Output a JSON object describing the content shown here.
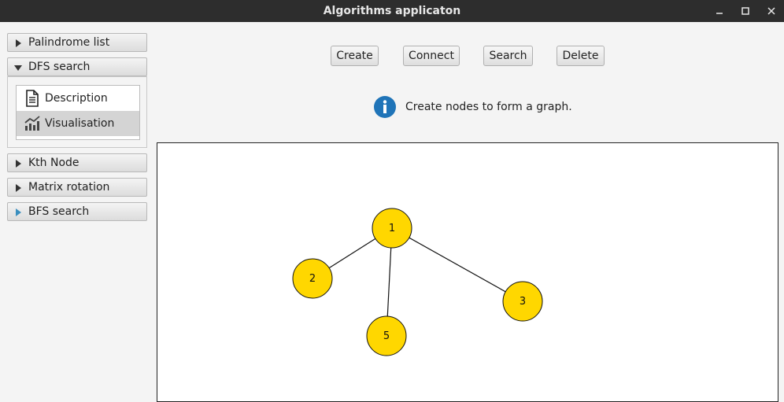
{
  "window": {
    "title": "Algorithms applicaton"
  },
  "sidebar": {
    "sections": [
      {
        "label": "Palindrome list",
        "expanded": false
      },
      {
        "label": "DFS search",
        "expanded": true
      },
      {
        "label": "Kth Node",
        "expanded": false
      },
      {
        "label": "Matrix rotation",
        "expanded": false
      },
      {
        "label": "BFS search",
        "expanded": false
      }
    ],
    "dfs_items": [
      {
        "label": "Description",
        "icon": "document-icon",
        "selected": false
      },
      {
        "label": "Visualisation",
        "icon": "chart-icon",
        "selected": true
      }
    ]
  },
  "toolbar": {
    "create_label": "Create",
    "connect_label": "Connect",
    "search_label": "Search",
    "delete_label": "Delete"
  },
  "info": {
    "icon": "info-icon",
    "message": "Create nodes to form a graph."
  },
  "graph": {
    "node_color": "#FFD700",
    "nodes": [
      {
        "id": "1",
        "label": "1"
      },
      {
        "id": "2",
        "label": "2"
      },
      {
        "id": "3",
        "label": "3"
      },
      {
        "id": "5",
        "label": "5"
      }
    ],
    "edges": [
      {
        "from": "1",
        "to": "2"
      },
      {
        "from": "1",
        "to": "3"
      },
      {
        "from": "1",
        "to": "5"
      }
    ]
  }
}
